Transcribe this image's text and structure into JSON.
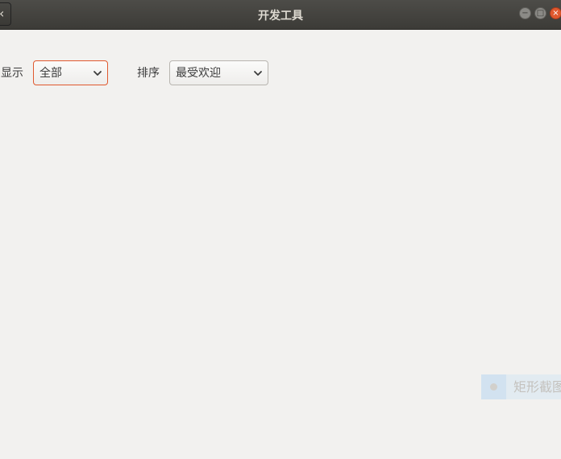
{
  "window": {
    "title": "开发工具",
    "back_glyph": "‹",
    "controls": [
      "minimize",
      "maximize",
      "close"
    ],
    "colors": {
      "titlebar": "#3c3b37",
      "close": "#e0592f",
      "background": "#f2f1ef"
    }
  },
  "filters": {
    "show": {
      "label": "显示",
      "selected": "全部"
    },
    "sort": {
      "label": "排序",
      "selected": "最受欢迎"
    }
  },
  "overlay": {
    "text": "矩形截图"
  },
  "icons": [
    "back-icon",
    "minimize-icon",
    "maximize-icon",
    "close-icon",
    "chevron-down-icon",
    "chevron-down-icon"
  ]
}
